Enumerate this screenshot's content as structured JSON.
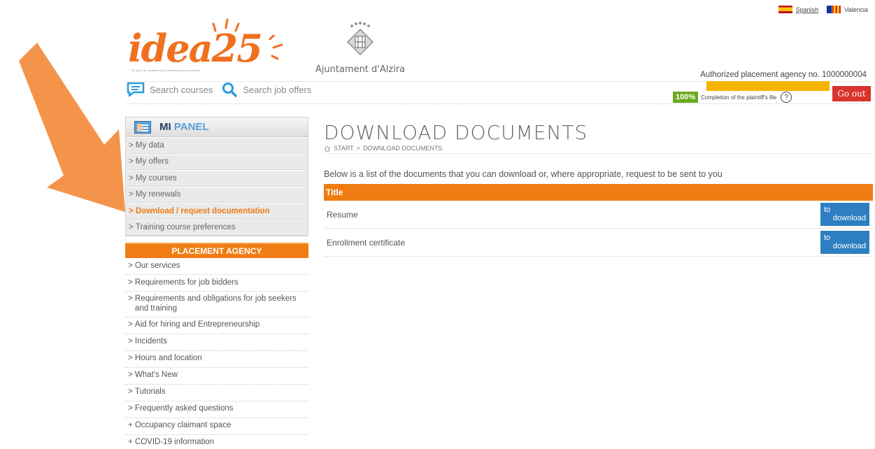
{
  "languages": [
    {
      "label": "Spanish"
    },
    {
      "label": "Valencia"
    }
  ],
  "logos": {
    "idea_brand": "idea25",
    "idea_tagline": "\"25 años\" de iniciativas por el desenvolupament d'Alzira",
    "ayto_name": "Ajuntament d'Alzira"
  },
  "header": {
    "agency_number": "Authorized placement agency no. 1000000004",
    "search_courses": "Search courses",
    "search_offers": "Search job offers",
    "completion_pct": "100%",
    "completion_label": "Completion of the plaintiff's file",
    "help": "?",
    "go_out": "Go out"
  },
  "sidebar": {
    "panel_mi": "MI",
    "panel_word": "PANEL",
    "items": [
      {
        "label": "My data"
      },
      {
        "label": "My offers"
      },
      {
        "label": "My courses"
      },
      {
        "label": "My renewals"
      },
      {
        "label": "Download / request documentation"
      },
      {
        "label": "Training course preferences"
      }
    ],
    "agency_title": "PLACEMENT AGENCY",
    "agency_items": [
      {
        "label": "Our services"
      },
      {
        "label": "Requirements for job bidders"
      },
      {
        "label": "Requirements and obligations for job seekers and training"
      },
      {
        "label": "Aid for hiring and Entrepreneurship"
      },
      {
        "label": "Incidents"
      },
      {
        "label": "Hours and location"
      },
      {
        "label": "What's New"
      },
      {
        "label": "Tutorials"
      },
      {
        "label": "Frequently asked questions"
      },
      {
        "label": "Occupancy claimant space"
      },
      {
        "label": "COVID-19 information"
      }
    ],
    "agency_markers": [
      ">",
      ">",
      ">",
      ">",
      ">",
      ">",
      ">",
      ">",
      ">",
      "+",
      "+"
    ]
  },
  "main": {
    "title": "DOWNLOAD DOCUMENTS",
    "breadcrumb_start": "START",
    "breadcrumb_sep": ">",
    "breadcrumb_current": "DOWNLOAD DOCUMENTS",
    "intro": "Below is a list of the documents that you can download or, where appropriate, request to be sent to you",
    "table_header": "Title",
    "rows": [
      {
        "title": "Resume",
        "btn_top": "to",
        "btn_bottom": "download"
      },
      {
        "title": "Enrollment certificate",
        "btn_top": "to",
        "btn_bottom": "download"
      }
    ]
  },
  "colors": {
    "accent_orange": "#ef7d13",
    "button_blue": "#2d7fc1",
    "go_out_red": "#d9332c",
    "progress_green": "#6aaa1e",
    "highlight_yellow": "#f5b400",
    "arrow_orange": "#f4944a"
  },
  "icons": {
    "lang_es": "spain-flag-icon",
    "lang_va": "valencia-flag-icon",
    "search_courses": "chat-card-icon",
    "search_offers": "magnifier-icon",
    "breadcrumb_home": "home-icon",
    "panel": "id-card-icon",
    "annotation": "orange-arrow"
  }
}
